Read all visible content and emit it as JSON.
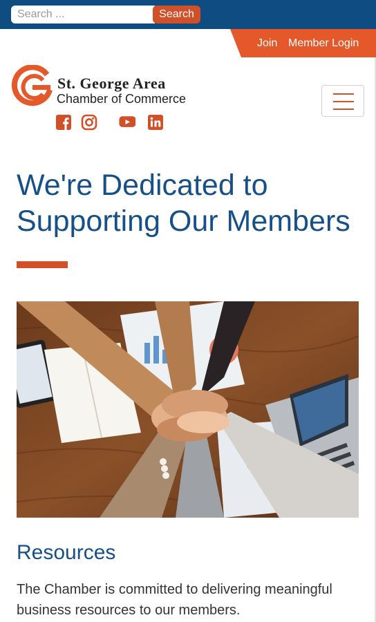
{
  "search": {
    "placeholder": "Search ...",
    "value": "",
    "button_label": "Search"
  },
  "member_nav": {
    "join_label": "Join",
    "login_label": "Member Login"
  },
  "logo": {
    "title": "St. George Area",
    "subtitle": "Chamber of Commerce"
  },
  "social": [
    {
      "icon": "facebook-icon"
    },
    {
      "icon": "instagram-icon"
    },
    {
      "icon": "youtube-icon"
    },
    {
      "icon": "linkedin-icon"
    }
  ],
  "hero": {
    "title": "We're Dedicated to Supporting Our Members"
  },
  "resources": {
    "title": "Resources",
    "text": "The Chamber is committed to delivering meaningful business resources to our members."
  },
  "colors": {
    "navy": "#0f4c81",
    "heading_blue": "#165087",
    "accent_orange": "#d0502a",
    "tab_orange": "#e4582a"
  }
}
